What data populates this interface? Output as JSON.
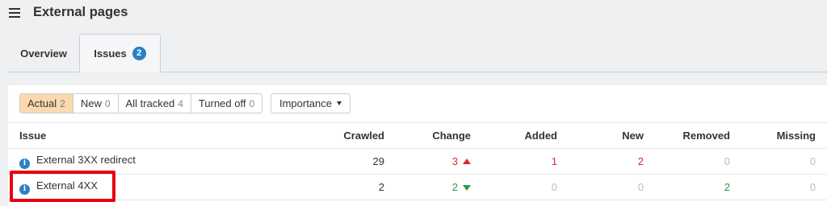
{
  "header": {
    "title": "External pages"
  },
  "tabs": [
    {
      "label": "Overview"
    },
    {
      "label": "Issues",
      "badge": "2"
    }
  ],
  "filters": [
    {
      "label": "Actual",
      "count": "2",
      "active": true
    },
    {
      "label": "New",
      "count": "0"
    },
    {
      "label": "All tracked",
      "count": "4"
    },
    {
      "label": "Turned off",
      "count": "0"
    }
  ],
  "importance": {
    "label": "Importance"
  },
  "table": {
    "columns": [
      "Issue",
      "Crawled",
      "Change",
      "Added",
      "New",
      "Removed",
      "Missing"
    ],
    "rows": [
      {
        "issue": "External 3XX redirect",
        "crawled": "29",
        "change": "3",
        "change_dir": "up",
        "added": "1",
        "new": "2",
        "removed": "0",
        "missing": "0"
      },
      {
        "issue": "External 4XX",
        "crawled": "2",
        "change": "2",
        "change_dir": "down",
        "added": "0",
        "new": "0",
        "removed": "2",
        "missing": "0"
      }
    ]
  },
  "colors": {
    "accent_blue": "#2a80c6",
    "active_filter": "#fbd9ae",
    "increase_red": "#d9262c",
    "decrease_green": "#2d9a4a",
    "highlight_box": "#e8000f"
  }
}
